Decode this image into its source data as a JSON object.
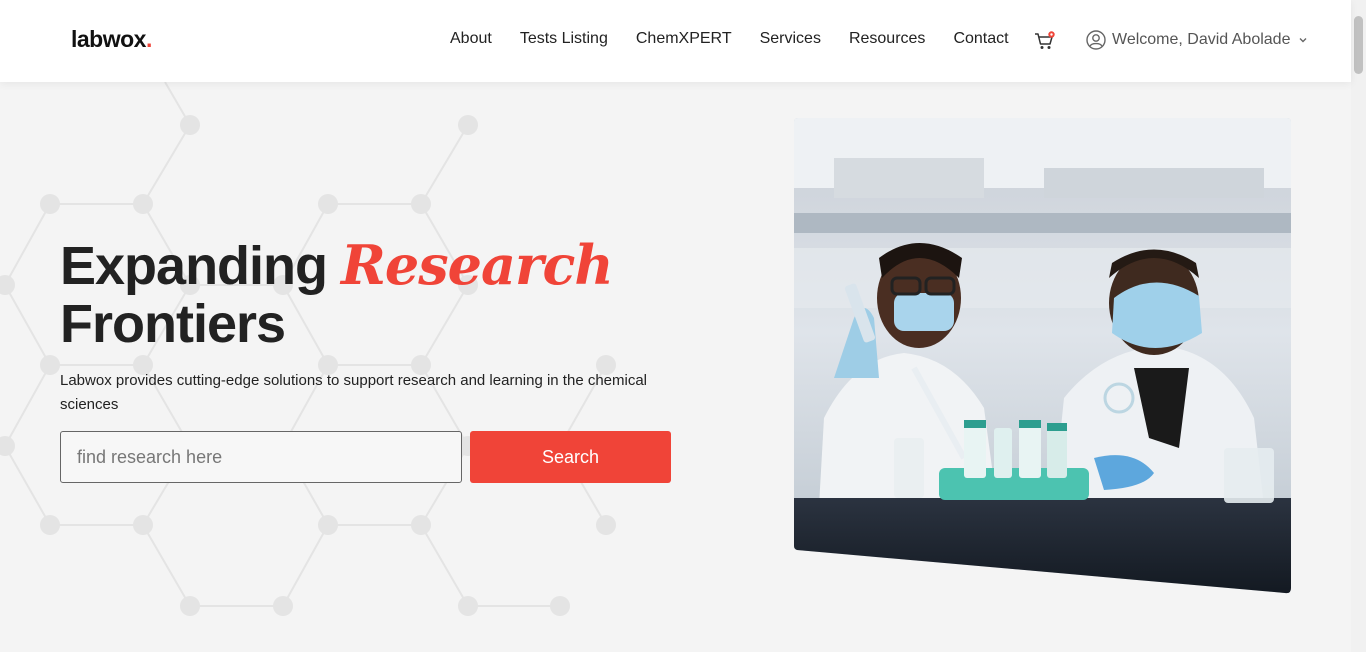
{
  "header": {
    "logo_text": "labwox",
    "logo_dot": ".",
    "nav": [
      {
        "label": "About"
      },
      {
        "label": "Tests Listing"
      },
      {
        "label": "ChemXPERT"
      },
      {
        "label": "Services"
      },
      {
        "label": "Resources"
      },
      {
        "label": "Contact"
      }
    ],
    "cart_icon": "cart-icon",
    "user_greeting": "Welcome, David Abolade"
  },
  "hero": {
    "title_part1": "Expanding ",
    "title_accent": "Research",
    "title_part2": "Frontiers",
    "subtitle": "Labwox provides cutting-edge solutions to support research and learning in the chemical sciences",
    "search_placeholder": "find research here",
    "search_button": "Search"
  },
  "colors": {
    "accent": "#f04438",
    "background": "#f4f4f4",
    "text": "#222222"
  }
}
